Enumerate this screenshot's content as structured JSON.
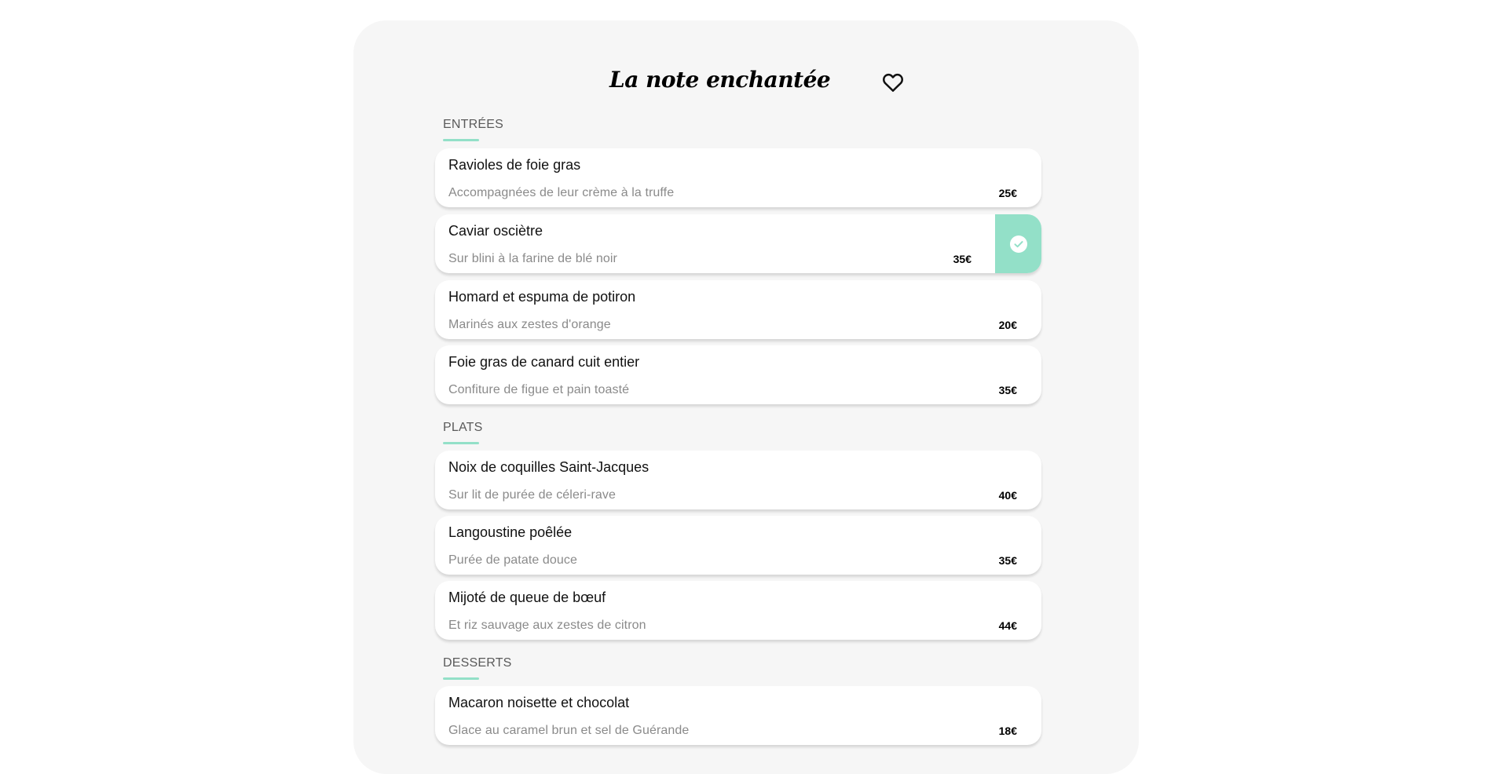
{
  "restaurant": {
    "title": "La note enchantée"
  },
  "icons": {
    "favorite": "heart-outline-icon",
    "selected": "check-circle-icon"
  },
  "colors": {
    "accent": "#93e0c8",
    "panel": "#f6f6f6"
  },
  "sections": [
    {
      "title": "ENTRÉES",
      "items": [
        {
          "name": "Ravioles de foie gras",
          "desc": "Accompagnées de leur crème à la truffe",
          "price": "25€"
        },
        {
          "name": "Caviar osciètre",
          "desc": "Sur blini à la farine de blé noir",
          "price": "35€",
          "selected": true
        },
        {
          "name": "Homard et espuma de potiron",
          "desc": "Marinés aux zestes d'orange",
          "price": "20€"
        },
        {
          "name": "Foie gras de canard cuit entier",
          "desc": "Confiture de figue et pain toasté",
          "price": "35€"
        }
      ]
    },
    {
      "title": "PLATS",
      "items": [
        {
          "name": "Noix de coquilles Saint-Jacques",
          "desc": "Sur lit de purée de céleri-rave",
          "price": "40€"
        },
        {
          "name": "Langoustine poêlée",
          "desc": "Purée de patate douce",
          "price": "35€"
        },
        {
          "name": "Mijoté de queue de bœuf",
          "desc": "Et riz sauvage aux zestes de citron",
          "price": "44€"
        }
      ]
    },
    {
      "title": "DESSERTS",
      "items": [
        {
          "name": "Macaron noisette et chocolat",
          "desc": "Glace au caramel brun et sel de Guérande",
          "price": "18€"
        }
      ]
    }
  ]
}
